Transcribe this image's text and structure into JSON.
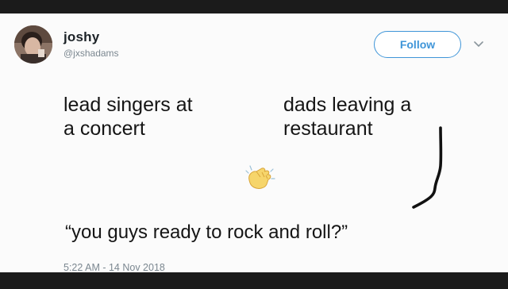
{
  "tweet": {
    "display_name": "joshy",
    "handle": "@jxshadams",
    "follow_label": "Follow",
    "left_line1": "lead singers at",
    "left_line2": "a concert",
    "right_line1": "dads leaving a",
    "right_line2": "restaurant",
    "quote": "“you guys ready to rock and roll?”",
    "timestamp": "5:22 AM - 14 Nov 2018"
  },
  "colors": {
    "accent": "#3f95d8",
    "background": "#1b1b1b",
    "card": "#fbfbfb",
    "muted_text": "#7b8790"
  },
  "icons": [
    "avatar",
    "chevron-down-icon",
    "clapping-hands-emoji",
    "hand-drawn-scribble"
  ]
}
